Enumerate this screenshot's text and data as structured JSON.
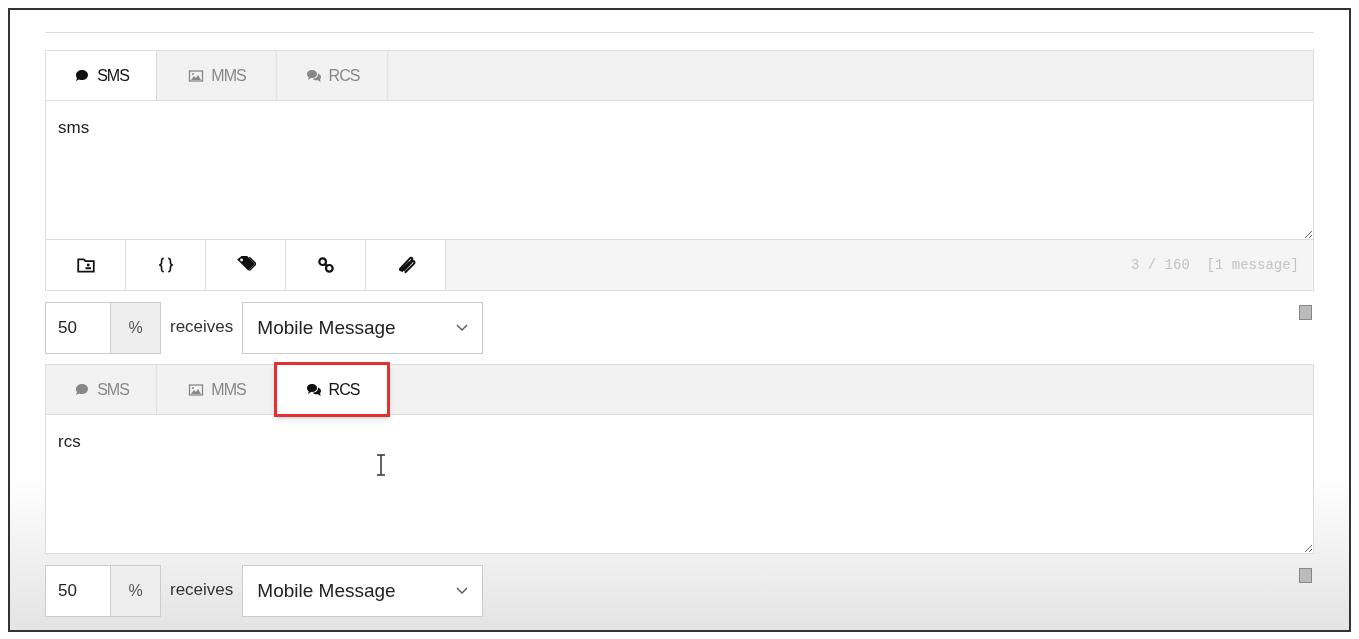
{
  "composers": [
    {
      "tabs": [
        {
          "label": "SMS",
          "kind": "bubble",
          "selected": true,
          "highlighted": false
        },
        {
          "label": "MMS",
          "kind": "image",
          "selected": false,
          "highlighted": false
        },
        {
          "label": "RCS",
          "kind": "bubbles",
          "selected": false,
          "highlighted": false
        }
      ],
      "message": "sms",
      "toolbar": {
        "buttons": [
          {
            "kind": "contacts"
          },
          {
            "kind": "braces"
          },
          {
            "kind": "tags"
          },
          {
            "kind": "link"
          },
          {
            "kind": "attach"
          }
        ],
        "counter": "3 / 160  [1 message]"
      },
      "share": {
        "value": "50",
        "unit": "%",
        "label": "receives",
        "channel": "Mobile Message"
      }
    },
    {
      "tabs": [
        {
          "label": "SMS",
          "kind": "bubble",
          "selected": false,
          "highlighted": false
        },
        {
          "label": "MMS",
          "kind": "image",
          "selected": false,
          "highlighted": false
        },
        {
          "label": "RCS",
          "kind": "bubbles",
          "selected": true,
          "highlighted": true
        }
      ],
      "message": "rcs",
      "share": {
        "value": "50",
        "unit": "%",
        "label": "receives",
        "channel": "Mobile Message"
      }
    }
  ]
}
